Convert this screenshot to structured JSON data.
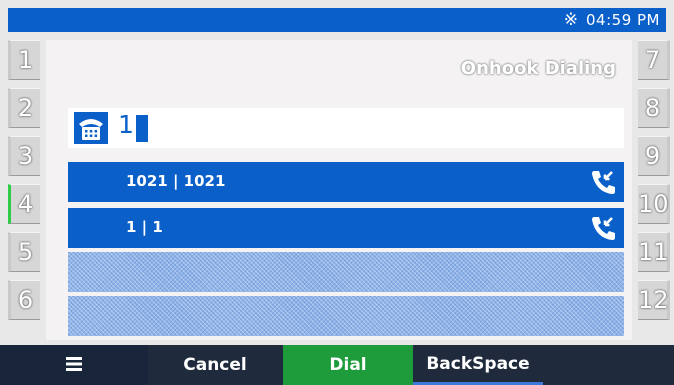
{
  "status_bar": {
    "bluetooth_icon": "bluetooth-icon",
    "time": "04:59 PM",
    "background": "#0a5fc9"
  },
  "screen": {
    "title": "Onhook Dialing"
  },
  "line_keys": {
    "left": [
      "1",
      "2",
      "3",
      "4",
      "5",
      "6"
    ],
    "right": [
      "7",
      "8",
      "9",
      "10",
      "11",
      "12"
    ],
    "active_index": 4,
    "active_color": "#2fcc48"
  },
  "dial_input": {
    "icon": "desk-phone-icon",
    "value": "1"
  },
  "suggestions": [
    {
      "text": "1021 | 1021",
      "icon": "incoming-call-icon"
    },
    {
      "text": "1 | 1",
      "icon": "incoming-call-icon"
    }
  ],
  "softkeys": {
    "menu_icon": "menu-icon",
    "cancel": "Cancel",
    "dial": "Dial",
    "backspace": "BackSpace",
    "dial_color": "#1e9c3c"
  }
}
